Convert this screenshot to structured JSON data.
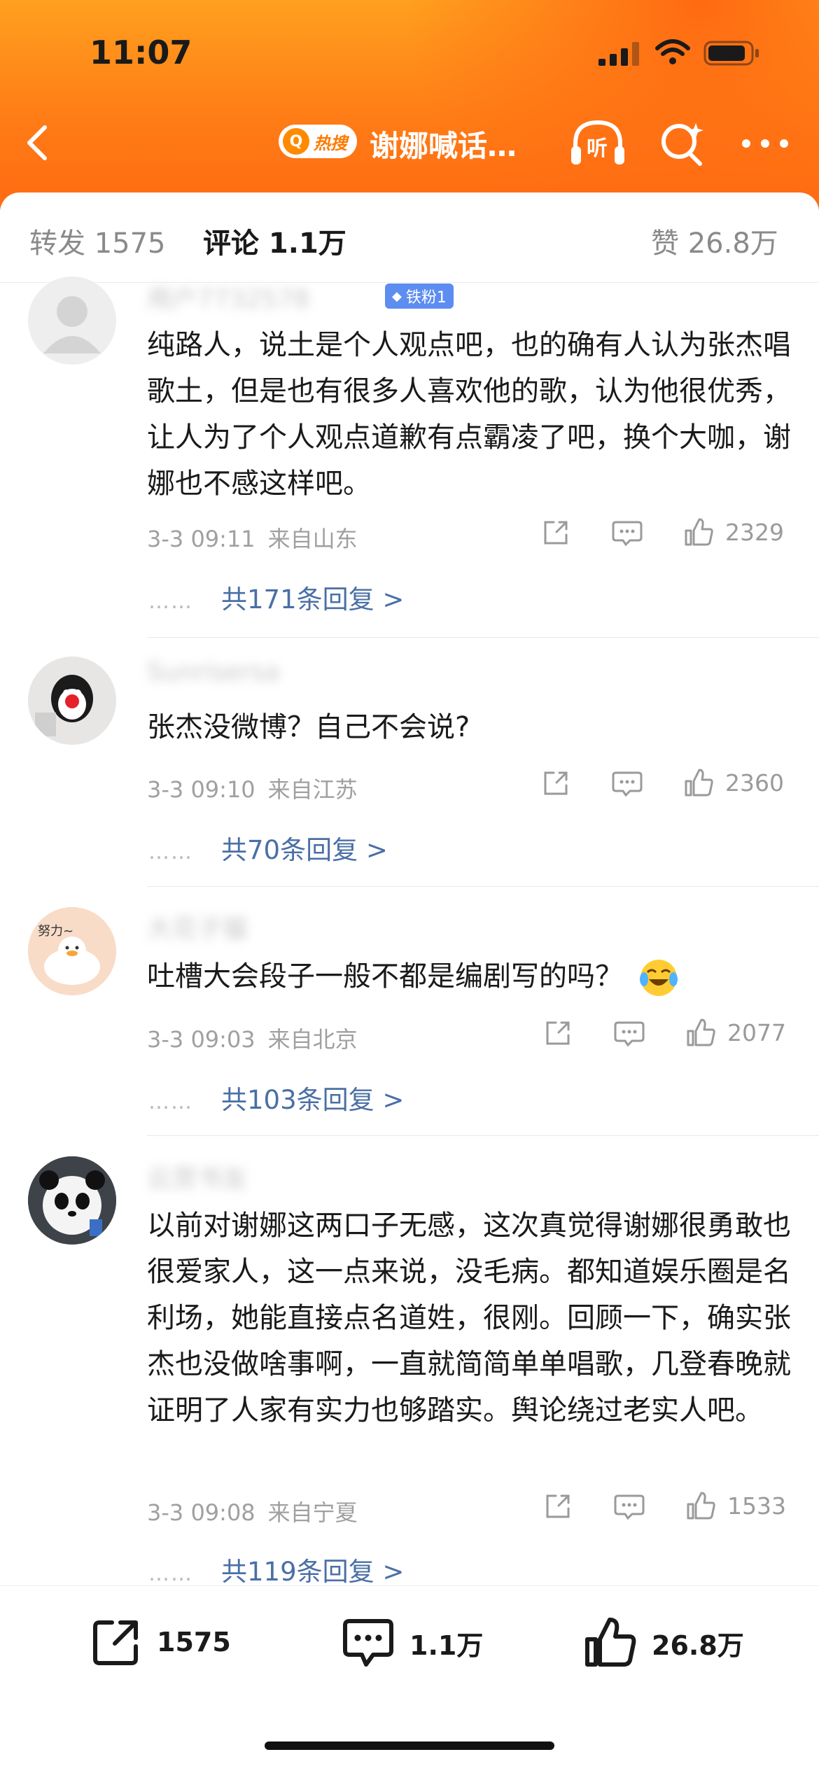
{
  "status_bar": {
    "time": "11:07"
  },
  "nav": {
    "hot_search_label": "热搜",
    "title": "谢娜喊话…",
    "listen_label": "听"
  },
  "tabs": [
    {
      "label": "转发 1575"
    },
    {
      "label": "评论 1.1万"
    },
    {
      "label": "赞 26.8万"
    }
  ],
  "comments": [
    {
      "username": "用户7732578",
      "badge": "铁粉1",
      "text": "纯路人，说土是个人观点吧，也的确有人认为张杰唱歌土，但是也有很多人喜欢他的歌，认为他很优秀，让人为了个人观点道歉有点霸凌了吧，换个大咖，谢娜也不感这样吧。",
      "date": "3-3 09:11",
      "location": "来自山东",
      "likes": "2329",
      "replies": "共171条回复 >"
    },
    {
      "username": "Sunrisersa",
      "text": "张杰没微博？自己不会说?",
      "date": "3-3 09:10",
      "location": "来自江苏",
      "likes": "2360",
      "replies": "共70条回复 >"
    },
    {
      "username": "大花子猫",
      "text": "吐槽大会段子一般不都是编剧写的吗？",
      "date": "3-3 09:03",
      "location": "来自北京",
      "likes": "2077",
      "replies": "共103条回复 >"
    },
    {
      "username": "云赏书友",
      "text": "以前对谢娜这两口子无感，这次真觉得谢娜很勇敢也很爱家人，这一点来说，没毛病。都知道娱乐圈是名利场，她能直接点名道姓，很刚。回顾一下，确实张杰也没做啥事啊，一直就简简单单唱歌，几登春晚就证明了人家有实力也够踏实。舆论绕过老实人吧。",
      "date": "3-3 09:08",
      "location": "来自宁夏",
      "likes": "1533",
      "replies": "共119条回复 >"
    }
  ],
  "replies_dots": "……",
  "bottom_bar": {
    "repost_count": "1575",
    "comment_count": "1.1万",
    "like_count": "26.8万"
  },
  "colors": {
    "header_orange": "#ff7d16",
    "link_blue": "#4a6fa5",
    "badge_blue": "#5d8df0"
  }
}
